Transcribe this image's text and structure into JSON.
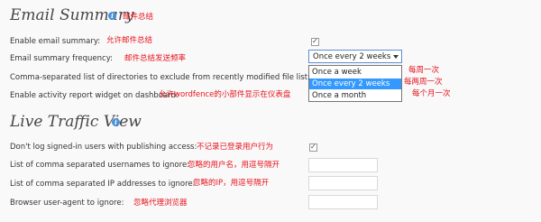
{
  "email_summary": {
    "title": "Email Summary",
    "title_annotation": "邮件总结",
    "enable_label": "Enable email summary:",
    "enable_annotation": "允许邮件总结",
    "enable_checked": true,
    "frequency_label": "Email summary frequency:",
    "frequency_annotation": "邮件总结发送频率",
    "frequency_selected": "Once every 2 weeks",
    "frequency_options": [
      {
        "label": "Once a week",
        "annotation": "每周一次"
      },
      {
        "label": "Once every 2 weeks",
        "annotation": "每两周一次"
      },
      {
        "label": "Once a month",
        "annotation": "每个月一次"
      }
    ],
    "exclude_dirs_label": "Comma-separated list of directories to exclude from recently modified file list:",
    "widget_label": "Enable activity report widget on dashboard:",
    "widget_annotation": "允许wordfence的小部件显示在仪表盘"
  },
  "live_traffic": {
    "title": "Live Traffic View",
    "dont_log_label": "Don't log signed-in users with publishing access:",
    "dont_log_annotation": "不记录已登录用户行为",
    "dont_log_checked": true,
    "usernames_label": "List of comma separated usernames to ignore:",
    "usernames_annotation": "忽略的用户名，用逗号隔开",
    "usernames_value": "",
    "ips_label": "List of comma separated IP addresses to ignore:",
    "ips_annotation": "忽略的IP，用逗号隔开",
    "ips_value": "",
    "useragent_label": "Browser user-agent to ignore:",
    "useragent_annotation": "忽略代理浏览器",
    "useragent_value": ""
  },
  "icons": {
    "info": "info-icon",
    "checkmark": "checkmark-icon",
    "dropdown_arrow": "chevron-down-icon"
  },
  "colors": {
    "annotation": "#e8141e",
    "selected_option": "#3399ff",
    "info_icon": "#4a90d9"
  }
}
